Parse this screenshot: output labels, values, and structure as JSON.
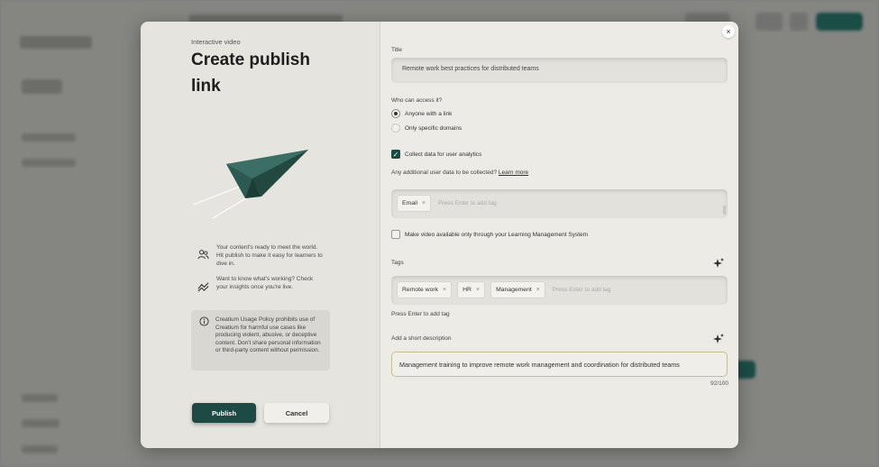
{
  "left_panel": {
    "eyebrow": "Interactive video",
    "heading": "Create publish link",
    "info_items": [
      {
        "icon": "users-icon",
        "text": "Your content's ready to meet the world. Hit publish to make it easy for learners to dive in."
      },
      {
        "icon": "trend-icon",
        "text": "Want to know what's working? Check your insights once you're live."
      }
    ],
    "policy_text": "Creatium Usage Policy prohibits use of Creatium for harmful use cases like producing violent, abusive, or deceptive content. Don't share personal information or third-party content without permission.",
    "publish_label": "Publish",
    "cancel_label": "Cancel"
  },
  "form": {
    "close_glyph": "×",
    "title_label": "Title",
    "title_value": "Remote work best practices for distributed teams",
    "access_label": "Who can access it?",
    "access_options": [
      {
        "label": "Anyone with a link",
        "selected": true
      },
      {
        "label": "Only specific domains",
        "selected": false
      }
    ],
    "collect_label": "Collect data for user analytics",
    "collect_checked": true,
    "additional_label": "Any additional user data to be collected?",
    "learn_more": "Learn more",
    "data_tags": [
      "Email"
    ],
    "tag_placeholder": "Press Enter to add tag",
    "lms_label": "Make video available only through your Learning Management System",
    "lms_checked": false,
    "tags_label": "Tags",
    "tags": [
      "Remote work",
      "HR",
      "Management"
    ],
    "tags_hint": "Press Enter to add tag",
    "desc_label": "Add a short description",
    "desc_value": "Management training to improve remote work management and coordination for distributed teams",
    "desc_counter": "92/100"
  },
  "colors": {
    "primary": "#1d4a44",
    "panel_left": "#e6e4df",
    "panel_right": "#edebe6"
  }
}
